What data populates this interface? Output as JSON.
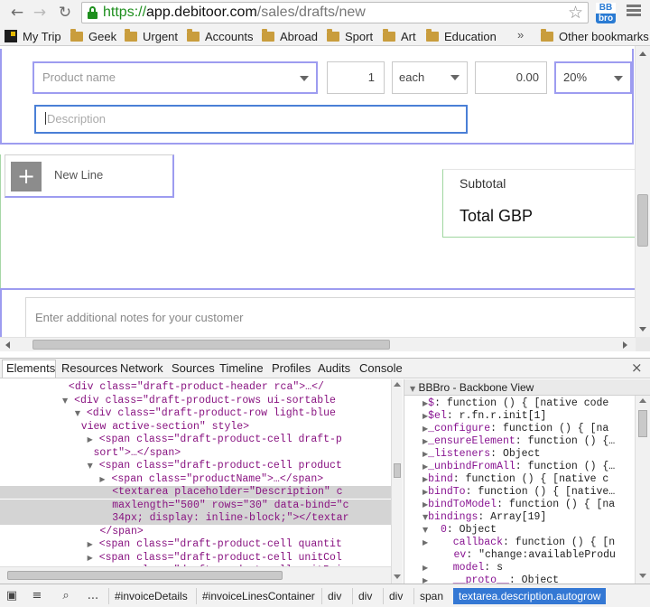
{
  "browser": {
    "url_scheme": "https://",
    "url_host": "app.debitoor.com",
    "url_path": "/sales/drafts/new",
    "extension_badge_top": "BB",
    "extension_badge_bottom": "bro"
  },
  "bookmarks": {
    "items": [
      {
        "label": "My Trip",
        "icon": "mytrip-icon"
      },
      {
        "label": "Geek",
        "icon": "folder-icon"
      },
      {
        "label": "Urgent",
        "icon": "folder-icon"
      },
      {
        "label": "Accounts",
        "icon": "folder-icon"
      },
      {
        "label": "Abroad",
        "icon": "folder-icon"
      },
      {
        "label": "Sport",
        "icon": "folder-icon"
      },
      {
        "label": "Art",
        "icon": "folder-icon"
      },
      {
        "label": "Education",
        "icon": "folder-icon"
      }
    ],
    "overflow": "»",
    "other": "Other bookmarks"
  },
  "invoice": {
    "product_placeholder": "Product name",
    "quantity": "1",
    "unit": "each",
    "price": "0.00",
    "vat": "20%",
    "description_placeholder": "Description",
    "new_line_label": "New Line",
    "plus_symbol": "+",
    "subtotal_label": "Subtotal",
    "total_label": "Total GBP",
    "notes_placeholder": "Enter additional notes for your customer"
  },
  "devtools": {
    "tabs": [
      "Elements",
      "Resources",
      "Network",
      "Sources",
      "Timeline",
      "Profiles",
      "Audits",
      "Console"
    ],
    "active_tab": "Elements",
    "close": "×",
    "side_title": "BBBro - Backbone View",
    "dom_lines": [
      {
        "pre": "          ",
        "tri": "",
        "html": "<div class=\"draft-product-header rca\">…</"
      },
      {
        "pre": "          ",
        "tri": "▼",
        "html": "<div class=\"draft-product-rows ui-sortable"
      },
      {
        "pre": "            ",
        "tri": "▼",
        "html": "<div class=\"draft-product-row light-blue"
      },
      {
        "pre": "            ",
        "tri": "",
        "html": "view active-section\" style>"
      },
      {
        "pre": "              ",
        "tri": "▶",
        "html": "<span class=\"draft-product-cell draft-p"
      },
      {
        "pre": "              ",
        "tri": "",
        "html": "sort\">…</span>"
      },
      {
        "pre": "              ",
        "tri": "▼",
        "html": "<span class=\"draft-product-cell product"
      },
      {
        "pre": "                ",
        "tri": "▶",
        "html": "<span class=\"productName\">…</span>"
      },
      {
        "pre": "                 ",
        "tri": "",
        "html": "<textarea placeholder=\"Description\" c"
      },
      {
        "pre": "                 ",
        "tri": "",
        "html": "maxlength=\"500\" rows=\"30\" data-bind=\"c"
      },
      {
        "pre": "                 ",
        "tri": "",
        "html": "34px; display: inline-block;\"></textar"
      },
      {
        "pre": "               ",
        "tri": "",
        "html": "</span>"
      },
      {
        "pre": "              ",
        "tri": "▶",
        "html": "<span class=\"draft-product-cell quantit"
      },
      {
        "pre": "              ",
        "tri": "▶",
        "html": "<span class=\"draft-product-cell unitCol"
      },
      {
        "pre": "              ",
        "tri": "▶",
        "html": "<span class=\"draft-product-cell unitPri"
      }
    ],
    "side_lines": [
      {
        "tri": "▶",
        "key": "$",
        "val": ": function () { [native code"
      },
      {
        "tri": "▶",
        "key": "$el",
        "val": ": r.fn.r.init[1]"
      },
      {
        "tri": "▶",
        "key": "_configure",
        "val": ": function () { [na"
      },
      {
        "tri": "▶",
        "key": "_ensureElement",
        "val": ": function () {…"
      },
      {
        "tri": "▶",
        "key": "_listeners",
        "val": ": Object"
      },
      {
        "tri": "▶",
        "key": "_unbindFromAll",
        "val": ": function () {…"
      },
      {
        "tri": "▶",
        "key": "bind",
        "val": ": function () { [native c"
      },
      {
        "tri": "▶",
        "key": "bindTo",
        "val": ": function () { [native…"
      },
      {
        "tri": "▶",
        "key": "bindToModel",
        "val": ": function () { [na"
      },
      {
        "tri": "▼",
        "key": "bindings",
        "val": ": Array[19]"
      },
      {
        "tri": "▼",
        "key": "  0",
        "val": ": Object"
      },
      {
        "tri": "▶",
        "key": "    callback",
        "val": ": function () { [n"
      },
      {
        "tri": "",
        "key": "     ev",
        "val": ": \"change:availableProdu"
      },
      {
        "tri": "▶",
        "key": "    model",
        "val": ": s"
      },
      {
        "tri": "▶",
        "key": "    __proto__",
        "val": ": Object"
      }
    ],
    "breadcrumbs": [
      "#invoiceDetails",
      "#invoiceLinesContainer",
      "div",
      "div",
      "div",
      "span",
      "textarea.description.autogrow"
    ],
    "status_more": "..."
  }
}
